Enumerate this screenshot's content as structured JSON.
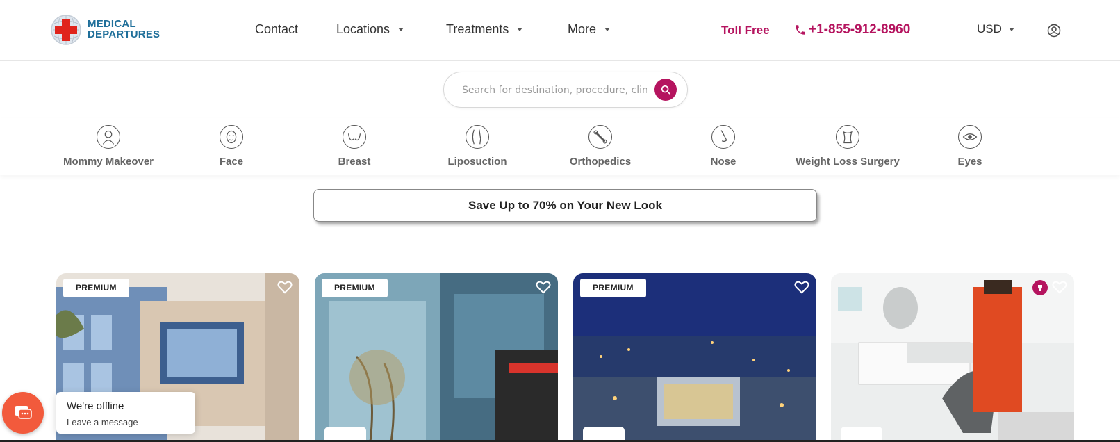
{
  "header": {
    "logo_line1": "MEDICAL",
    "logo_line2": "DEPARTURES",
    "nav": [
      {
        "label": "Contact"
      },
      {
        "label": "Locations"
      },
      {
        "label": "Treatments"
      },
      {
        "label": "More"
      }
    ],
    "toll_free_label": "Toll Free",
    "phone": "+1-855-912-8960",
    "currency": "USD"
  },
  "search": {
    "placeholder": "Search for destination, procedure, clinic or doctor"
  },
  "categories": [
    {
      "label": "Mommy Makeover",
      "icon": "mommy-makeover-icon"
    },
    {
      "label": "Face",
      "icon": "face-icon"
    },
    {
      "label": "Breast",
      "icon": "breast-icon"
    },
    {
      "label": "Liposuction",
      "icon": "liposuction-icon"
    },
    {
      "label": "Orthopedics",
      "icon": "orthopedics-icon"
    },
    {
      "label": "Nose",
      "icon": "nose-icon"
    },
    {
      "label": "Weight Loss Surgery",
      "icon": "weight-loss-icon"
    },
    {
      "label": "Eyes",
      "icon": "eyes-icon"
    }
  ],
  "promo": {
    "label": "Save Up to 70% on Your New Look"
  },
  "cards": [
    {
      "badge": "PREMIUM"
    },
    {
      "badge": "PREMIUM"
    },
    {
      "badge": "PREMIUM"
    },
    {
      "badge": ""
    }
  ],
  "chat": {
    "title": "We're offline",
    "subtitle": "Leave a message"
  },
  "colors": {
    "accent": "#b5145f",
    "brand_blue": "#1f6f9a",
    "logo_red": "#e0241c",
    "chat_orange": "#f25a3c"
  }
}
